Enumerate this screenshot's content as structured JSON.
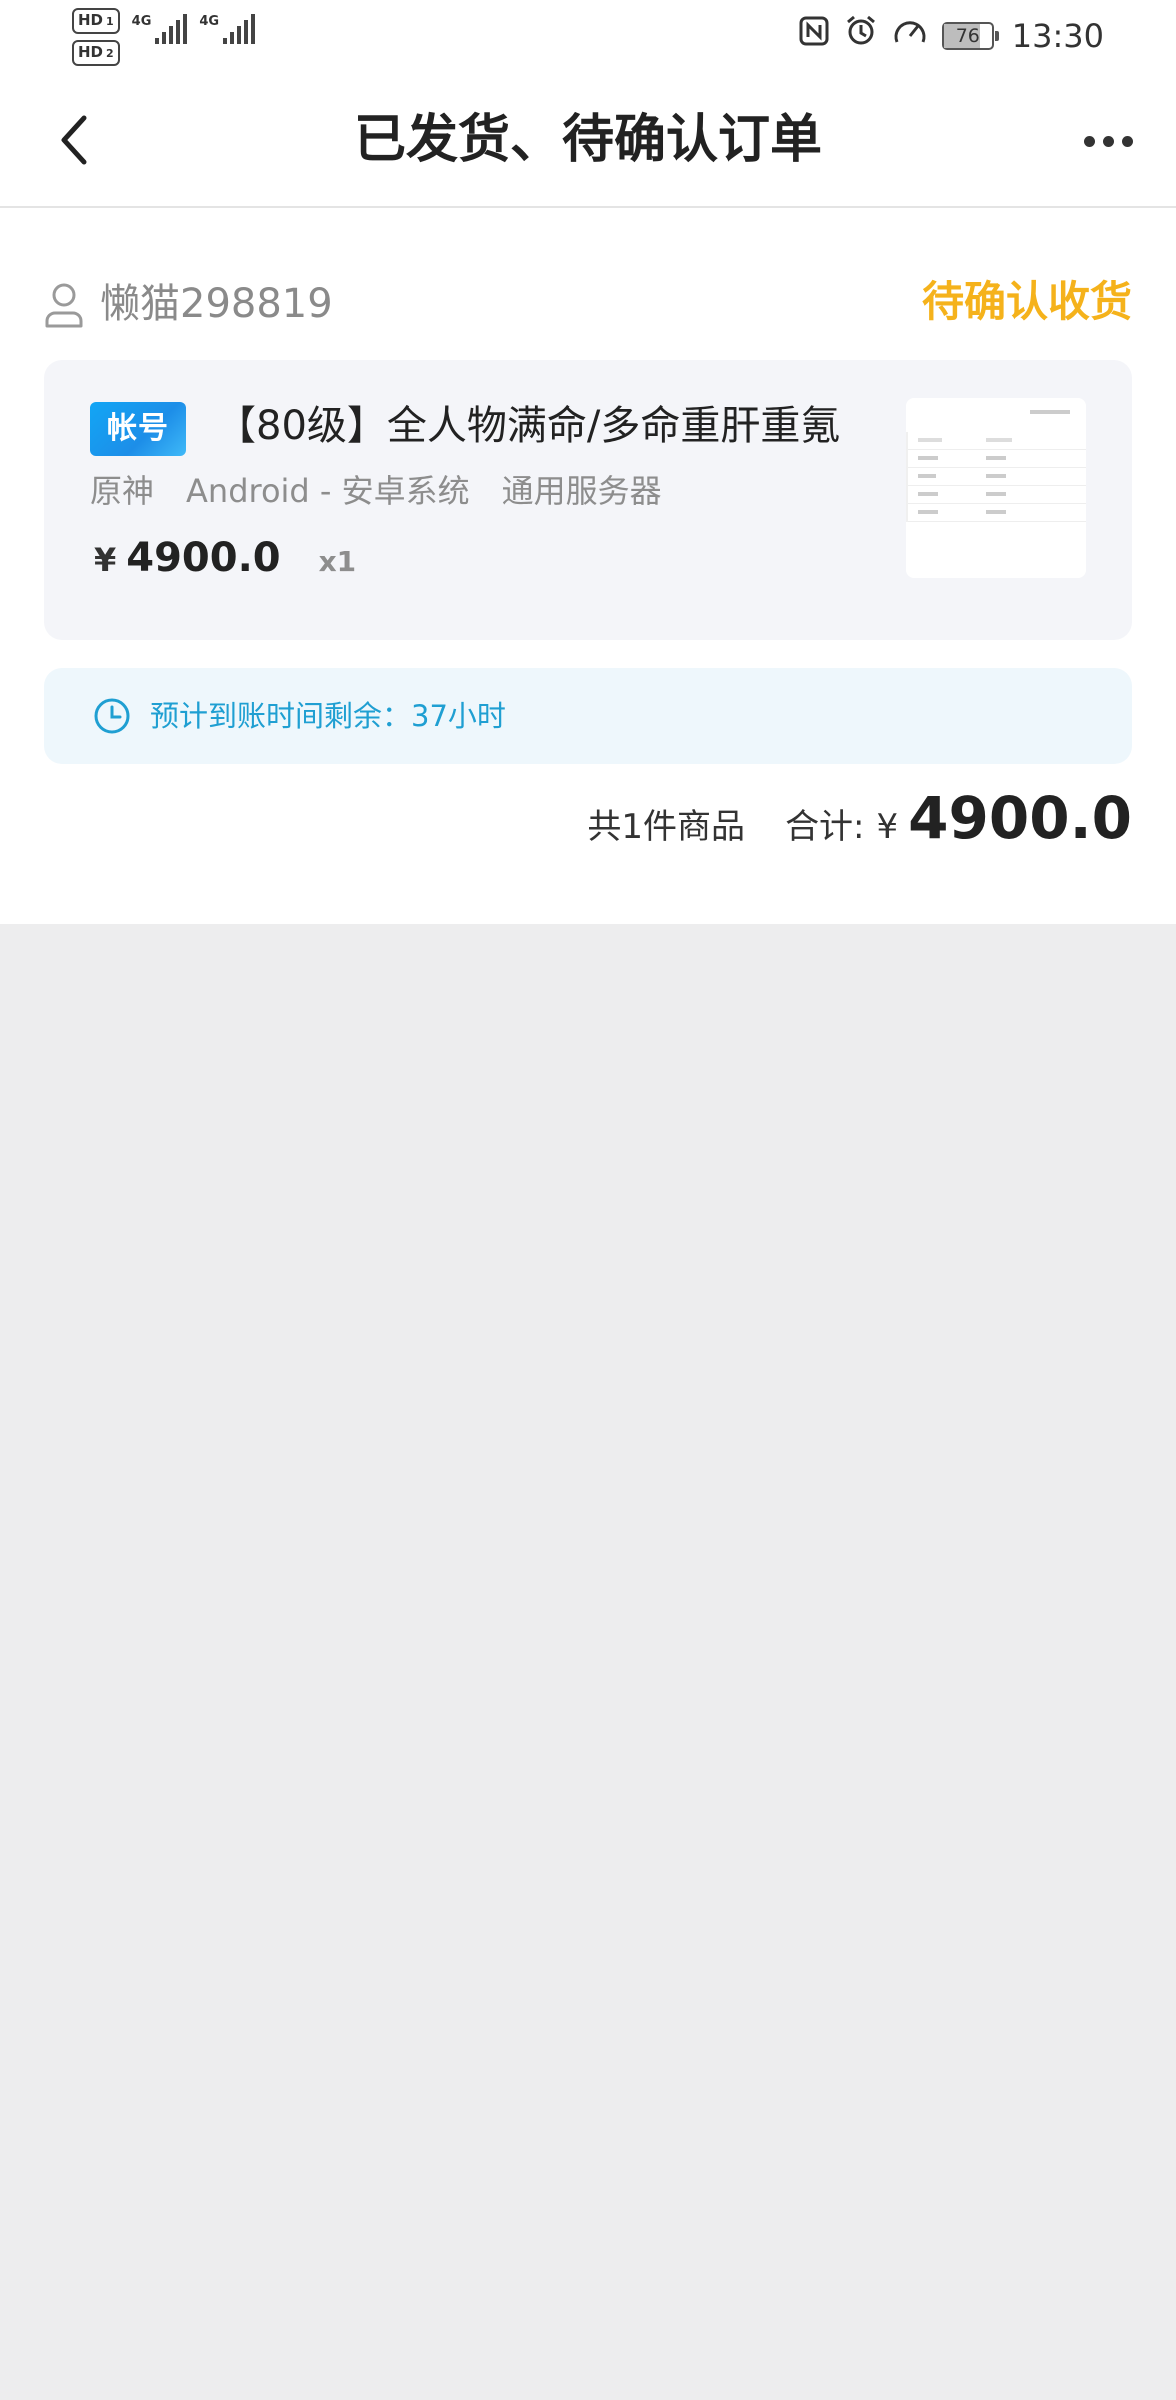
{
  "status_bar": {
    "sim1": "HD",
    "sim1_index": "1",
    "sim2": "HD",
    "sim2_index": "2",
    "network1": "4G",
    "network2": "4G",
    "battery": "76",
    "time": "13:30",
    "icons": [
      "nfc-icon",
      "alarm-icon",
      "speedometer-icon"
    ]
  },
  "nav": {
    "title": "已发货、待确认订单"
  },
  "order": {
    "user_name": "懒猫298819",
    "status": "待确认收货",
    "item": {
      "tag": "帐号",
      "title": "【80级】全人物满命/多命重肝重氪",
      "meta": [
        "原神",
        "Android - 安卓系统",
        "通用服务器"
      ],
      "currency": "¥",
      "price": "4900.0",
      "quantity": "x1"
    },
    "notice": "预计到账时间剩余：37小时",
    "summary": {
      "count_text": "共1件商品",
      "total_label": "合计:",
      "currency": "¥",
      "total": "4900.0"
    }
  },
  "colors": {
    "status": "#f5b21b",
    "notice_text": "#1f9fd2",
    "notice_bg": "#eef7fc",
    "tag_bg": "#12a6f5",
    "page_bg": "#ededee"
  }
}
